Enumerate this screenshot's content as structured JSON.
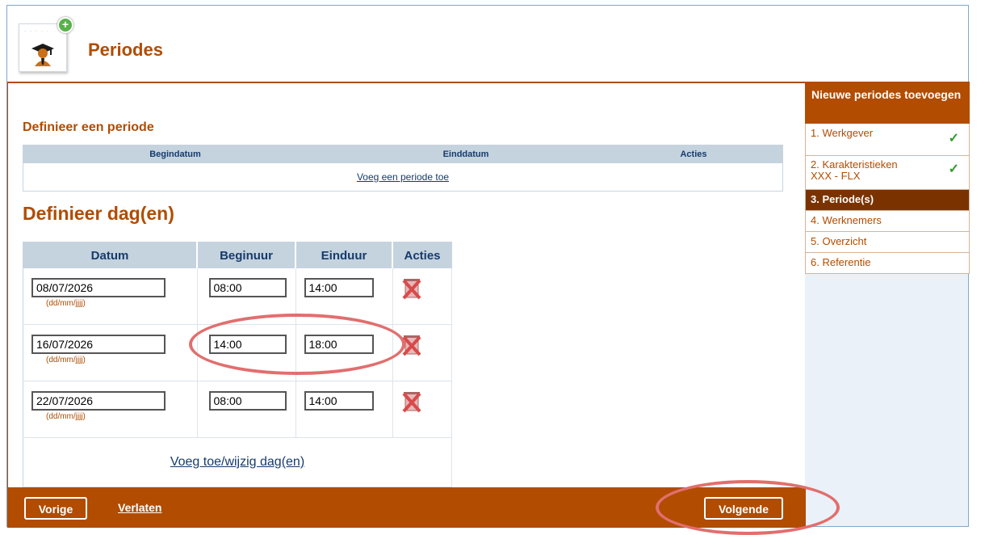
{
  "header": {
    "title": "Periodes",
    "logo_icon": "graduate-icon",
    "badge_icon": "plus-icon"
  },
  "period_section": {
    "title": "Definieer een periode",
    "columns": [
      "Begindatum",
      "Einddatum",
      "Acties"
    ],
    "add_link": "Voeg een periode toe"
  },
  "days_section": {
    "title": "Definieer dag(en)",
    "columns": [
      "Datum",
      "Beginuur",
      "Einduur",
      "Acties"
    ],
    "date_hint": "(dd/mm/jjjj)",
    "rows": [
      {
        "date": "08/07/2026",
        "start": "08:00",
        "end": "14:00"
      },
      {
        "date": "16/07/2026",
        "start": "14:00",
        "end": "18:00"
      },
      {
        "date": "22/07/2026",
        "start": "08:00",
        "end": "14:00"
      }
    ],
    "add_link": "Voeg toe/wijzig dag(en)"
  },
  "footer": {
    "prev_label": "Vorige",
    "leave_label": "Verlaten",
    "next_label": "Volgende"
  },
  "sidebar": {
    "title": "Nieuwe periodes toevoegen",
    "steps": [
      {
        "label": "1. Werkgever",
        "sub": "",
        "done": true
      },
      {
        "label": "2. Karakteristieken",
        "sub": "XXX - FLX",
        "done": true
      },
      {
        "label": "3. Periode(s)",
        "sub": "",
        "done": false
      },
      {
        "label": "4. Werknemers",
        "sub": "",
        "done": false
      },
      {
        "label": "5. Overzicht",
        "sub": "",
        "done": false
      },
      {
        "label": "6. Referentie",
        "sub": "",
        "done": false
      }
    ],
    "check_glyph": "✓"
  },
  "colors": {
    "accent": "#b14c00",
    "table_header": "#c5d3df",
    "highlight_oval": "#e26e6e",
    "check": "#2f9b2a"
  }
}
